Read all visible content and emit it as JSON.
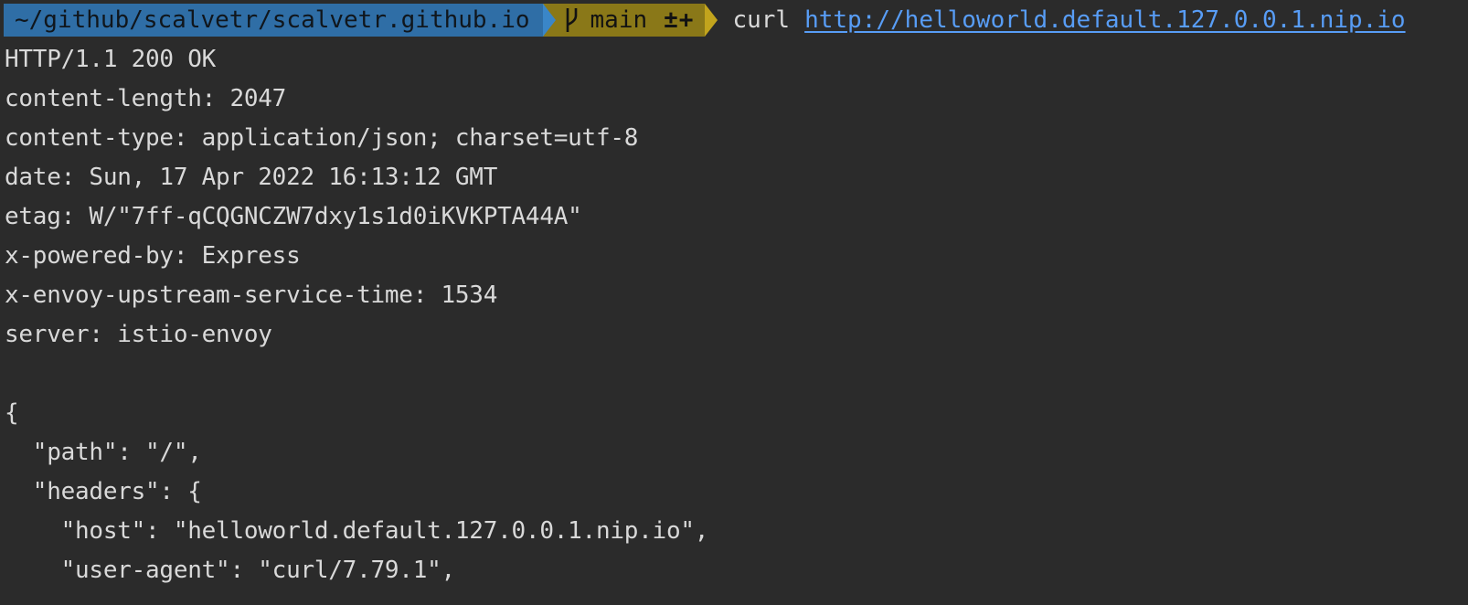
{
  "prompt": {
    "directory": "~/github/scalvetr/scalvetr.github.io",
    "branch_icon": "git-branch-icon",
    "branch": "main",
    "status_flags": "±+",
    "command": "curl",
    "url": "http://helloworld.default.127.0.0.1.nip.io",
    "colors": {
      "directory_bg": "#2f6ea6",
      "git_bg": "#8a7818",
      "link": "#589df6",
      "background": "#2b2b2b",
      "text": "#d9d9d9"
    }
  },
  "output_lines": [
    "HTTP/1.1 200 OK",
    "content-length: 2047",
    "content-type: application/json; charset=utf-8",
    "date: Sun, 17 Apr 2022 16:13:12 GMT",
    "etag: W/\"7ff-qCQGNCZW7dxy1s1d0iKVKPTA44A\"",
    "x-powered-by: Express",
    "x-envoy-upstream-service-time: 1534",
    "server: istio-envoy",
    "",
    "{",
    "  \"path\": \"/\",",
    "  \"headers\": {",
    "    \"host\": \"helloworld.default.127.0.0.1.nip.io\",",
    "    \"user-agent\": \"curl/7.79.1\","
  ]
}
